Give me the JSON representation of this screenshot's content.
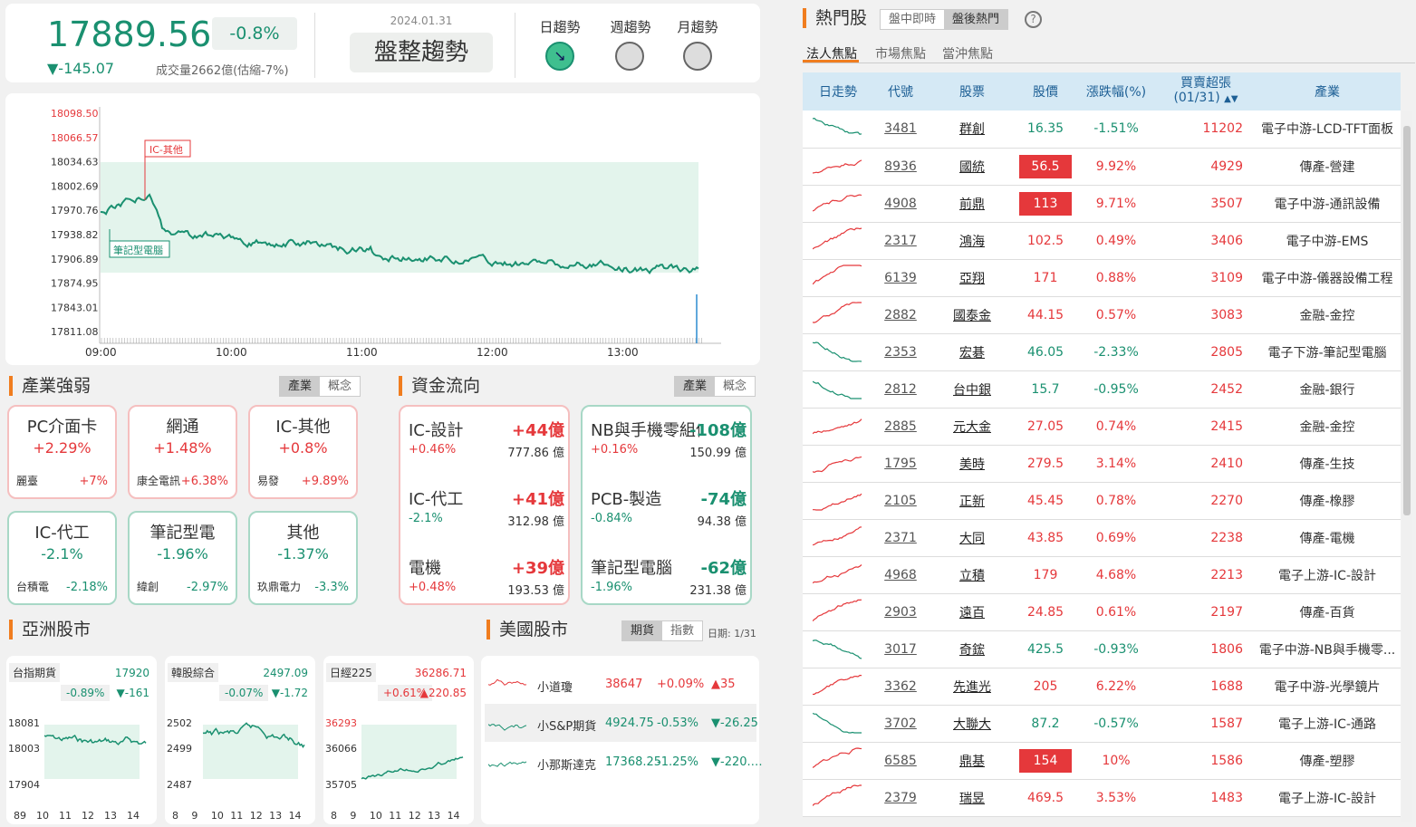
{
  "index": {
    "value": "17889.56",
    "pct": "-0.8%",
    "change": "▼-145.07",
    "volume": "成交量2662億(估縮-7%)"
  },
  "trend": {
    "date": "2024.01.31",
    "label": "盤整趨勢",
    "items": [
      "日趨勢",
      "週趨勢",
      "月趨勢"
    ]
  },
  "chart": {
    "yticks": [
      "18098.50",
      "18066.57",
      "18034.63",
      "18002.69",
      "17970.76",
      "17938.82",
      "17906.89",
      "17874.95",
      "17843.01",
      "17811.08"
    ],
    "xticks": [
      "09:00",
      "10:00",
      "11:00",
      "12:00",
      "13:00"
    ],
    "tag_up": "IC-其他",
    "tag_dn": "筆記型電腦"
  },
  "industry": {
    "title": "產業強弱",
    "tabs": [
      "產業",
      "概念"
    ],
    "cards": [
      {
        "name": "PC介面卡",
        "pct": "+2.29%",
        "stock": "麗臺",
        "spct": "+7%",
        "dir": "up"
      },
      {
        "name": "網通",
        "pct": "+1.48%",
        "stock": "康全電訊",
        "spct": "+6.38%",
        "dir": "up"
      },
      {
        "name": "IC-其他",
        "pct": "+0.8%",
        "stock": "易發",
        "spct": "+9.89%",
        "dir": "up"
      },
      {
        "name": "IC-代工",
        "pct": "-2.1%",
        "stock": "台積電",
        "spct": "-2.18%",
        "dir": "dn"
      },
      {
        "name": "筆記型電",
        "pct": "-1.96%",
        "stock": "緯創",
        "spct": "-2.97%",
        "dir": "dn"
      },
      {
        "name": "其他",
        "pct": "-1.37%",
        "stock": "玖鼎電力",
        "spct": "-3.3%",
        "dir": "dn"
      }
    ]
  },
  "flow": {
    "title": "資金流向",
    "tabs": [
      "產業",
      "概念"
    ],
    "left": [
      {
        "name": "IC-設計",
        "val": "+44億",
        "pct": "+0.46%",
        "amt": "777.86 億"
      },
      {
        "name": "IC-代工",
        "val": "+41億",
        "pct": "-2.1%",
        "amt": "312.98 億"
      },
      {
        "name": "電機",
        "val": "+39億",
        "pct": "+0.48%",
        "amt": "193.53 億"
      }
    ],
    "right": [
      {
        "name": "NB與手機零組件",
        "val": "-108億",
        "pct": "+0.16%",
        "amt": "150.99 億"
      },
      {
        "name": "PCB-製造",
        "val": "-74億",
        "pct": "-0.84%",
        "amt": "94.38 億"
      },
      {
        "name": "筆記型電腦",
        "val": "-62億",
        "pct": "-1.96%",
        "amt": "231.38 億"
      }
    ]
  },
  "asia": {
    "title": "亞洲股市",
    "markets": [
      {
        "name": "台指期貨",
        "value": "17920",
        "pct": "-0.89%",
        "chg": "▼-161",
        "y": [
          "18081",
          "18003",
          "17904"
        ],
        "x": [
          "89",
          "10",
          "11",
          "12",
          "13",
          "14"
        ],
        "dir": "dn"
      },
      {
        "name": "韓股綜合",
        "value": "2497.09",
        "pct": "-0.07%",
        "chg": "▼-1.72",
        "y": [
          "2502",
          "2499",
          "2487"
        ],
        "x": [
          "8",
          "9",
          "10",
          "11",
          "12",
          "13",
          "14"
        ],
        "dir": "dn"
      },
      {
        "name": "日經225",
        "value": "36286.71",
        "pct": "+0.61%",
        "chg": "▲220.85",
        "y": [
          "36293",
          "36066",
          "35705"
        ],
        "x": [
          "8",
          "9",
          "10",
          "11",
          "12",
          "13",
          "14"
        ],
        "dir": "up"
      }
    ]
  },
  "us": {
    "title": "美國股市",
    "tabs": [
      "期貨",
      "指數"
    ],
    "date": "日期: 1/31",
    "rows": [
      {
        "name": "小道瓊",
        "value": "38647",
        "pct": "+0.09%",
        "chg": "▲35",
        "dir": "up"
      },
      {
        "name": "小S&P期貨",
        "value": "4924.75",
        "pct": "-0.53%",
        "chg": "▼-26.25",
        "dir": "dn"
      },
      {
        "name": "小那斯達克",
        "value": "17368.25",
        "pct": "-1.25%",
        "chg": "▼-220.…",
        "dir": "dn"
      }
    ]
  },
  "hot": {
    "title": "熱門股",
    "tabs": [
      "盤中即時",
      "盤後熱門"
    ],
    "subtabs": [
      "法人焦點",
      "市場焦點",
      "當沖焦點"
    ],
    "headers": [
      "日走勢",
      "代號",
      "股票",
      "股價",
      "漲跌幅(%)",
      "買賣超張",
      "(01/31)",
      "產業"
    ],
    "rows": [
      {
        "code": "3481",
        "name": "群創",
        "price": "16.35",
        "pct": "-1.51%",
        "vol": "11202",
        "ind": "電子中游-LCD-TFT面板",
        "dir": "dn",
        "lim": false
      },
      {
        "code": "8936",
        "name": "國統",
        "price": "56.5",
        "pct": "9.92%",
        "vol": "4929",
        "ind": "傳產-營建",
        "dir": "up",
        "lim": true
      },
      {
        "code": "4908",
        "name": "前鼎",
        "price": "113",
        "pct": "9.71%",
        "vol": "3507",
        "ind": "電子中游-通訊設備",
        "dir": "up",
        "lim": true
      },
      {
        "code": "2317",
        "name": "鴻海",
        "price": "102.5",
        "pct": "0.49%",
        "vol": "3406",
        "ind": "電子中游-EMS",
        "dir": "up",
        "lim": false
      },
      {
        "code": "6139",
        "name": "亞翔",
        "price": "171",
        "pct": "0.88%",
        "vol": "3109",
        "ind": "電子中游-儀器設備工程",
        "dir": "up",
        "lim": false
      },
      {
        "code": "2882",
        "name": "國泰金",
        "price": "44.15",
        "pct": "0.57%",
        "vol": "3083",
        "ind": "金融-金控",
        "dir": "up",
        "lim": false
      },
      {
        "code": "2353",
        "name": "宏碁",
        "price": "46.05",
        "pct": "-2.33%",
        "vol": "2805",
        "ind": "電子下游-筆記型電腦",
        "dir": "dn",
        "lim": false
      },
      {
        "code": "2812",
        "name": "台中銀",
        "price": "15.7",
        "pct": "-0.95%",
        "vol": "2452",
        "ind": "金融-銀行",
        "dir": "dn",
        "lim": false
      },
      {
        "code": "2885",
        "name": "元大金",
        "price": "27.05",
        "pct": "0.74%",
        "vol": "2415",
        "ind": "金融-金控",
        "dir": "up",
        "lim": false
      },
      {
        "code": "1795",
        "name": "美時",
        "price": "279.5",
        "pct": "3.14%",
        "vol": "2410",
        "ind": "傳產-生技",
        "dir": "up",
        "lim": false
      },
      {
        "code": "2105",
        "name": "正新",
        "price": "45.45",
        "pct": "0.78%",
        "vol": "2270",
        "ind": "傳產-橡膠",
        "dir": "up",
        "lim": false
      },
      {
        "code": "2371",
        "name": "大同",
        "price": "43.85",
        "pct": "0.69%",
        "vol": "2238",
        "ind": "傳產-電機",
        "dir": "up",
        "lim": false
      },
      {
        "code": "4968",
        "name": "立積",
        "price": "179",
        "pct": "4.68%",
        "vol": "2213",
        "ind": "電子上游-IC-設計",
        "dir": "up",
        "lim": false
      },
      {
        "code": "2903",
        "name": "遠百",
        "price": "24.85",
        "pct": "0.61%",
        "vol": "2197",
        "ind": "傳產-百貨",
        "dir": "up",
        "lim": false
      },
      {
        "code": "3017",
        "name": "奇鋐",
        "price": "425.5",
        "pct": "-0.93%",
        "vol": "1806",
        "ind": "電子中游-NB與手機零...",
        "dir": "dn",
        "lim": false
      },
      {
        "code": "3362",
        "name": "先進光",
        "price": "205",
        "pct": "6.22%",
        "vol": "1688",
        "ind": "電子中游-光學鏡片",
        "dir": "up",
        "lim": false
      },
      {
        "code": "3702",
        "name": "大聯大",
        "price": "87.2",
        "pct": "-0.57%",
        "vol": "1587",
        "ind": "電子上游-IC-通路",
        "dir": "dn",
        "lim": false
      },
      {
        "code": "6585",
        "name": "鼎基",
        "price": "154",
        "pct": "10%",
        "vol": "1586",
        "ind": "傳產-塑膠",
        "dir": "up",
        "lim": true
      },
      {
        "code": "2379",
        "name": "瑞昱",
        "price": "469.5",
        "pct": "3.53%",
        "vol": "1483",
        "ind": "電子上游-IC-設計",
        "dir": "up",
        "lim": false
      }
    ]
  }
}
